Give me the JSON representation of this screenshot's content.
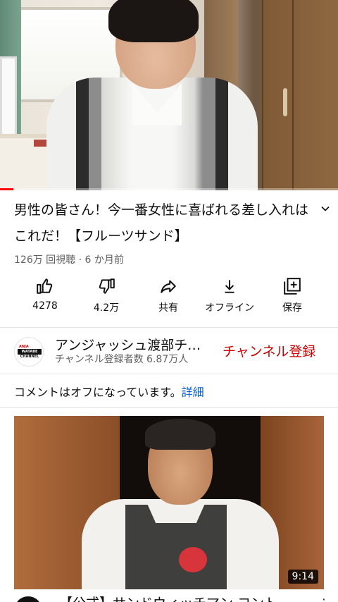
{
  "player": {
    "progress_fraction": 0.04
  },
  "video": {
    "title": "男性の皆さん！今一番女性に喜ばれる差し入れはこれだ！【フルーツサンド】",
    "meta": "126万 回視聴 · 6 か月前",
    "expand_icon": "chevron-down-icon"
  },
  "actions": [
    {
      "id": "like",
      "icon": "thumbs-up-icon",
      "label": "4278"
    },
    {
      "id": "dislike",
      "icon": "thumbs-down-icon",
      "label": "4.2万"
    },
    {
      "id": "share",
      "icon": "share-icon",
      "label": "共有"
    },
    {
      "id": "offline",
      "icon": "download-icon",
      "label": "オフライン"
    },
    {
      "id": "save",
      "icon": "add-to-playlist-icon",
      "label": "保存"
    }
  ],
  "channel": {
    "avatar_top": "ANJA",
    "avatar_mid": "WATABE",
    "avatar_bot": "CHANNEL",
    "name": "アンジャッシュ渡部チャンネル",
    "subscribers": "チャンネル登録者数 6.87万人",
    "subscribe_label": "チャンネル登録"
  },
  "comments": {
    "text": "コメントはオフになっています。",
    "link": "詳細"
  },
  "next_video": {
    "duration": "9:14",
    "title": "【公式】サンドウィッチマン コント",
    "more_icon": "more-vert-icon"
  },
  "colors": {
    "subscribe": "#cc0000",
    "link": "#065fd4",
    "progress": "#ff0000",
    "secondary_text": "#606060"
  }
}
